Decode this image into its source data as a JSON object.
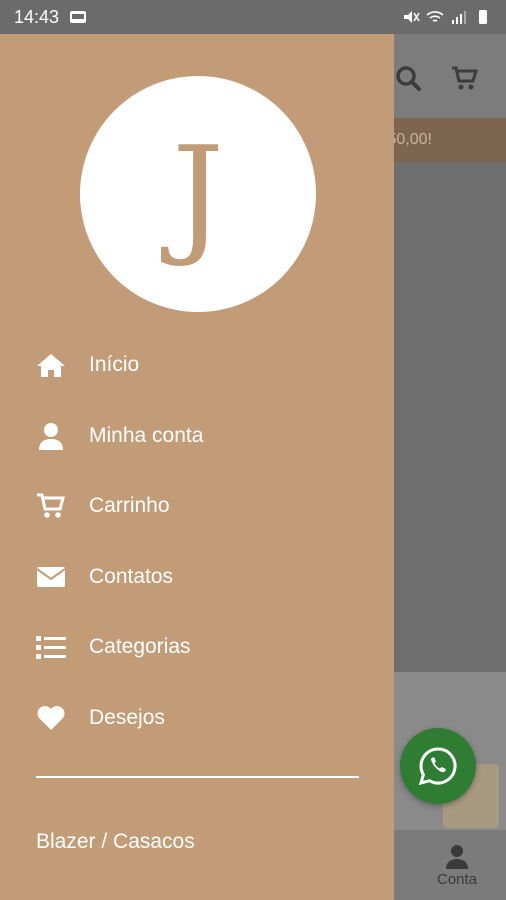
{
  "status_bar": {
    "time": "14:43"
  },
  "background": {
    "promo_text": "50,00!",
    "nav_account_label": "Conta"
  },
  "drawer": {
    "logo_letter": "J",
    "menu": [
      {
        "label": "Início",
        "icon": "home-icon"
      },
      {
        "label": "Minha conta",
        "icon": "user-icon"
      },
      {
        "label": "Carrinho",
        "icon": "cart-icon"
      },
      {
        "label": "Contatos",
        "icon": "envelope-icon"
      },
      {
        "label": "Categorias",
        "icon": "list-icon"
      },
      {
        "label": "Desejos",
        "icon": "heart-icon"
      }
    ],
    "category": "Blazer / Casacos"
  },
  "colors": {
    "drawer_bg": "#c19c76",
    "whatsapp": "#2e7d32"
  }
}
